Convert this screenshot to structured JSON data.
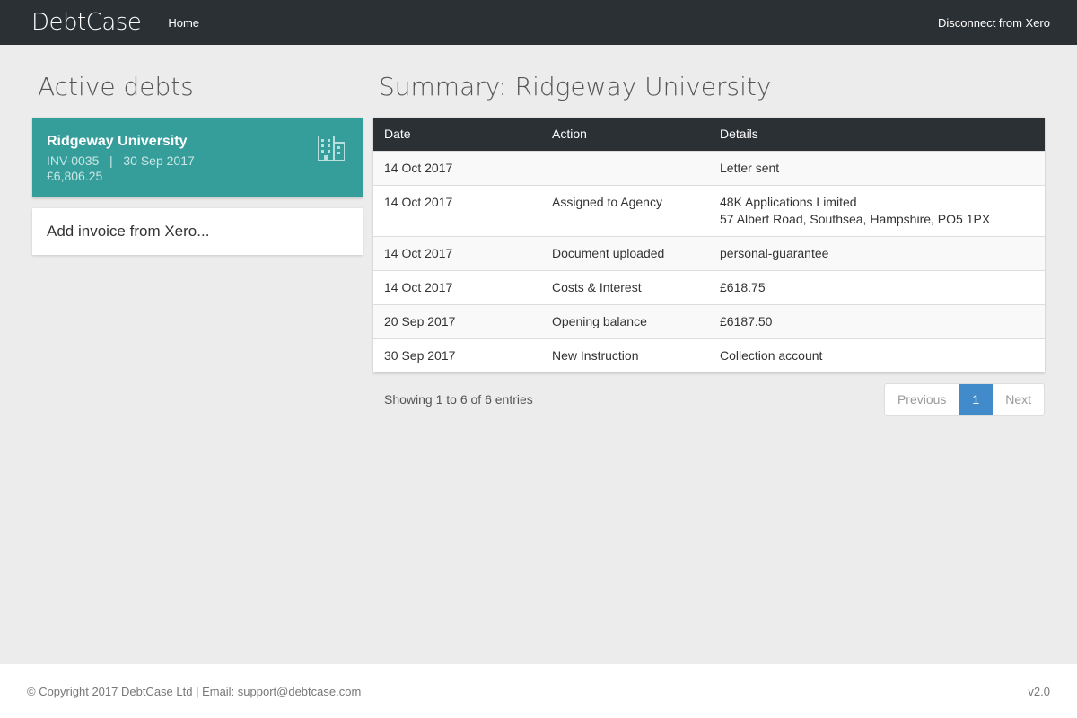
{
  "header": {
    "logo": "DebtCase",
    "nav_home": "Home",
    "nav_disconnect": "Disconnect from Xero"
  },
  "sidebar": {
    "title": "Active debts",
    "debt_card": {
      "name": "Ridgeway University",
      "invoice": "INV-0035",
      "separator": "|",
      "date": "30 Sep 2017",
      "amount": "£6,806.25"
    },
    "add_invoice": "Add invoice from Xero..."
  },
  "content": {
    "title": "Summary: Ridgeway University",
    "table": {
      "headers": [
        "Date",
        "Action",
        "Details"
      ],
      "rows": [
        {
          "date": "14 Oct 2017",
          "action": "",
          "details": "Letter sent",
          "details2": ""
        },
        {
          "date": "14 Oct 2017",
          "action": "Assigned to Agency",
          "details": "48K Applications Limited",
          "details2": "57 Albert Road, Southsea, Hampshire, PO5 1PX"
        },
        {
          "date": "14 Oct 2017",
          "action": "Document uploaded",
          "details": "personal-guarantee",
          "details2": ""
        },
        {
          "date": "14 Oct 2017",
          "action": "Costs & Interest",
          "details": "£618.75",
          "details2": ""
        },
        {
          "date": "20 Sep 2017",
          "action": "Opening balance",
          "details": "£6187.50",
          "details2": ""
        },
        {
          "date": "30 Sep 2017",
          "action": "New Instruction",
          "details": "Collection account",
          "details2": ""
        }
      ]
    },
    "entries_info": "Showing 1 to 6 of 6 entries",
    "pagination": {
      "previous": "Previous",
      "current": "1",
      "next": "Next"
    }
  },
  "footer": {
    "copyright": "© Copyright 2017 DebtCase Ltd  |  Email: support@debtcase.com",
    "version": "v2.0"
  },
  "colors": {
    "header_bg": "#2b3034",
    "card_accent": "#369e9a",
    "page_active": "#428bca"
  }
}
